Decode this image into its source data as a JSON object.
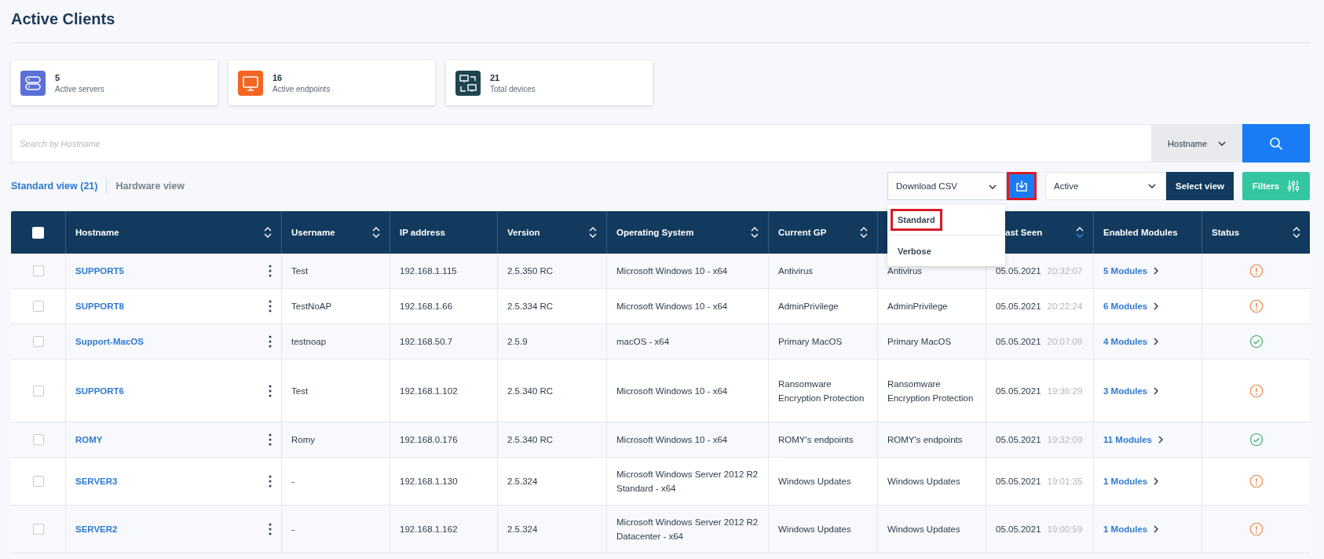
{
  "page": {
    "title": "Active Clients"
  },
  "stats": [
    {
      "kind": "servers",
      "value": "5",
      "label": "Active servers",
      "color": "#5b6fd8"
    },
    {
      "kind": "endpoints",
      "value": "16",
      "label": "Active endpoints",
      "color": "#f26522"
    },
    {
      "kind": "devices",
      "value": "21",
      "label": "Total devices",
      "color": "#1d4550"
    }
  ],
  "search": {
    "placeholder": "Search by Hostname",
    "field": "Hostname"
  },
  "view_tabs": [
    {
      "label": "Standard view (21)",
      "selected": true
    },
    {
      "label": "Hardware view",
      "selected": false
    }
  ],
  "export": {
    "label": "Download CSV",
    "expanded": true,
    "download_highlighted": true,
    "options": [
      {
        "label": "Standard",
        "highlighted": true
      },
      {
        "label": "Verbose",
        "highlighted": false
      }
    ]
  },
  "view_select": {
    "value": "Active",
    "button": "Select view"
  },
  "filters_button": "Filters",
  "table": {
    "all_checked": false,
    "columns": [
      {
        "label": "Hostname",
        "sortable": true,
        "sorted": false
      },
      {
        "label": "Username",
        "sortable": true,
        "sorted": false
      },
      {
        "label": "IP address",
        "sortable": false,
        "sorted": false
      },
      {
        "label": "Version",
        "sortable": true,
        "sorted": false
      },
      {
        "label": "Operating System",
        "sortable": true,
        "sorted": false
      },
      {
        "label": "Current GP",
        "sortable": true,
        "sorted": false
      },
      {
        "label": "ast Seen",
        "sortable": true,
        "sorted": true
      },
      {
        "label": "Enabled Modules",
        "sortable": false,
        "sorted": false
      },
      {
        "label": "Status",
        "sortable": true,
        "sorted": false
      }
    ],
    "rows": [
      {
        "checked": false,
        "hostname": "SUPPORT5",
        "username": "Test",
        "ip": "192.168.1.115",
        "version": "2.5.350 RC",
        "os": "Microsoft Windows 10 - x64",
        "current_gp": "Antivirus",
        "column_7": "Antivirus",
        "date": "05.05.2021",
        "time": "20:32:07",
        "modules": "5 Modules",
        "status_ok": false
      },
      {
        "checked": false,
        "hostname": "SUPPORT8",
        "username": "TestNoAP",
        "ip": "192.168.1.66",
        "version": "2.5.334 RC",
        "os": "Microsoft Windows 10 - x64",
        "current_gp": "AdminPrivilege",
        "column_7": "AdminPrivilege",
        "date": "05.05.2021",
        "time": "20:22:24",
        "modules": "6 Modules",
        "status_ok": false
      },
      {
        "checked": false,
        "hostname": "Support-MacOS",
        "username": "testnoap",
        "ip": "192.168.50.7",
        "version": "2.5.9",
        "os": "macOS - x64",
        "current_gp": "Primary MacOS",
        "column_7": "Primary MacOS",
        "date": "05.05.2021",
        "time": "20:07:09",
        "modules": "4 Modules",
        "status_ok": true
      },
      {
        "checked": false,
        "hostname": "SUPPORT6",
        "username": "Test",
        "ip": "192.168.1.102",
        "version": "2.5.340 RC",
        "os": "Microsoft Windows 10 - x64",
        "current_gp": "Ransomware Encryption Protection",
        "column_7": "Ransomware Encryption Protection",
        "date": "05.05.2021",
        "time": "19:36:29",
        "modules": "3 Modules",
        "status_ok": false
      },
      {
        "checked": false,
        "hostname": "ROMY",
        "username": "Romy",
        "ip": "192.168.0.176",
        "version": "2.5.340 RC",
        "os": "Microsoft Windows 10 - x64",
        "current_gp": "ROMY's endpoints",
        "column_7": "ROMY's endpoints",
        "date": "05.05.2021",
        "time": "19:32:09",
        "modules": "11 Modules",
        "status_ok": true
      },
      {
        "checked": false,
        "hostname": "SERVER3",
        "username": "-",
        "ip": "192.168.1.130",
        "version": "2.5.324",
        "os": "Microsoft Windows Server 2012 R2 Standard - x64",
        "current_gp": "Windows Updates",
        "column_7": "Windows Updates",
        "date": "05.05.2021",
        "time": "19:01:35",
        "modules": "1 Modules",
        "status_ok": false
      },
      {
        "checked": false,
        "hostname": "SERVER2",
        "username": "-",
        "ip": "192.168.1.162",
        "version": "2.5.324",
        "os": "Microsoft Windows Server 2012 R2 Datacenter - x64",
        "current_gp": "Windows Updates",
        "column_7": "Windows Updates",
        "date": "05.05.2021",
        "time": "19:00:59",
        "modules": "1 Modules",
        "status_ok": false
      }
    ]
  }
}
